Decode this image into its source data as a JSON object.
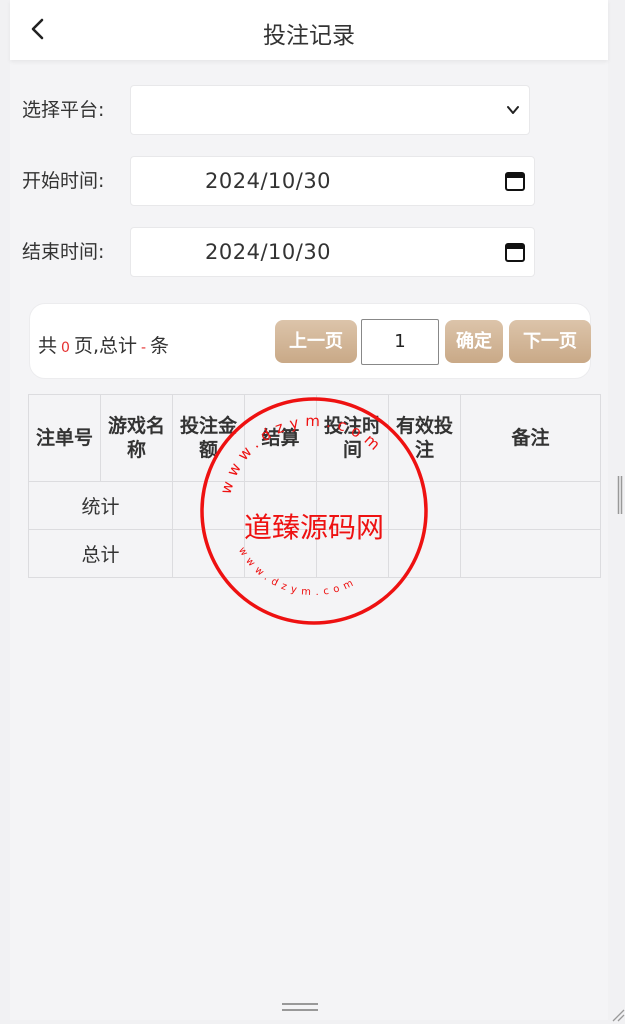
{
  "header": {
    "title": "投注记录",
    "back_icon": "chevron-left-icon"
  },
  "filters": {
    "platform_label": "选择平台:",
    "platform_value": "",
    "start_label": "开始时间:",
    "start_value": "2024/10/30",
    "end_label": "结束时间:",
    "end_value": "2024/10/30"
  },
  "pager": {
    "prefix": "共",
    "pages": "0",
    "middle": "页,总计",
    "total": "-",
    "suffix": "条",
    "prev_label": "上一页",
    "page_value": "1",
    "confirm_label": "确定",
    "next_label": "下一页"
  },
  "table": {
    "columns": [
      "注单号",
      "游戏名称",
      "投注金额",
      "结算",
      "投注时间",
      "有效投注",
      "备注"
    ],
    "rows": [
      {
        "label": "统计"
      },
      {
        "label": "总计"
      }
    ]
  },
  "watermark": {
    "text": "道臻源码网",
    "top_arc": "www.dzym.com",
    "bottom_arc": "www.dzym.com"
  },
  "colors": {
    "accent": "#c9a987",
    "highlight": "#e53030",
    "stamp": "#e11111"
  }
}
